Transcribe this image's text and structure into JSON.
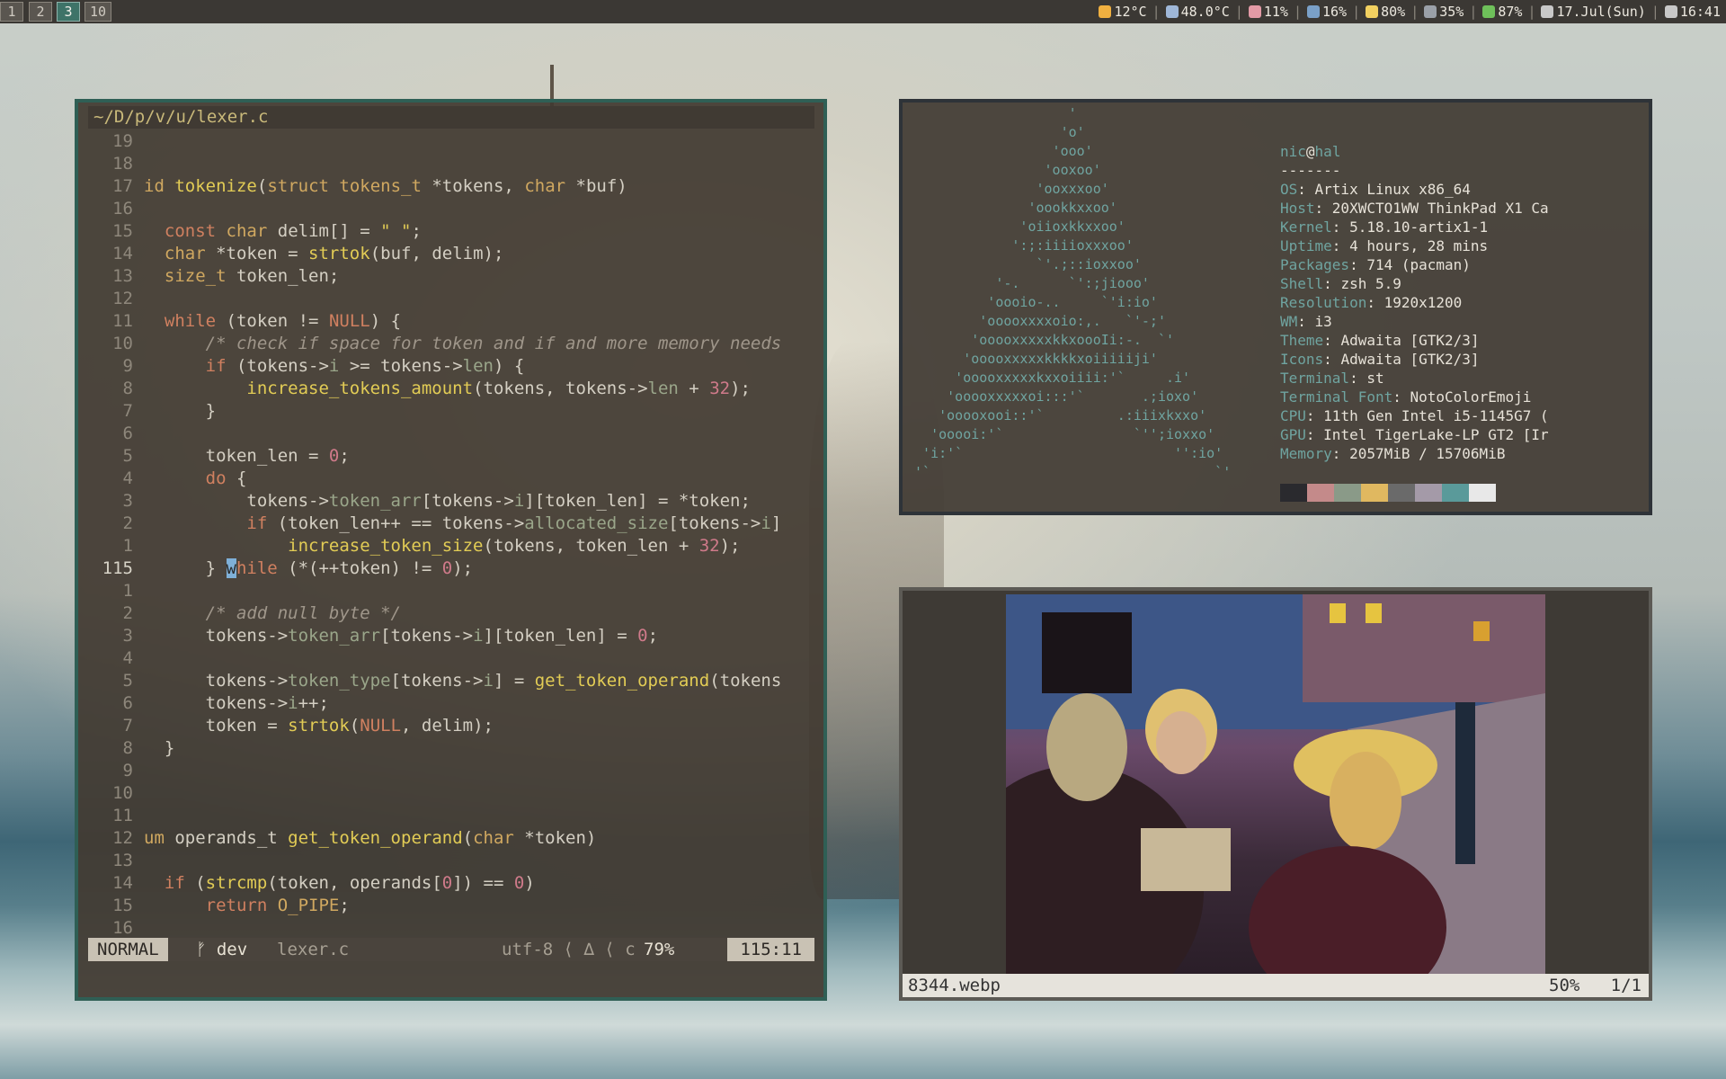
{
  "workspaces": [
    "1",
    "2",
    "3",
    "10"
  ],
  "active_workspace": "3",
  "status": [
    {
      "icon": "sun-icon",
      "text": "12°C",
      "color": "#f0b040"
    },
    {
      "icon": "laptop-icon",
      "text": "48.0°C",
      "color": "#9fb7d8"
    },
    {
      "icon": "brain-icon",
      "text": "11%",
      "color": "#e39aa6"
    },
    {
      "icon": "floppy-icon",
      "text": "16%",
      "color": "#7aa0c8"
    },
    {
      "icon": "bulb-icon",
      "text": "80%",
      "color": "#f2d060"
    },
    {
      "icon": "speaker-icon",
      "text": "35%",
      "color": "#9aa0a8"
    },
    {
      "icon": "battery-icon",
      "text": "87%",
      "color": "#6ec05a"
    },
    {
      "icon": "calendar-icon",
      "text": "17.Jul(Sun)",
      "color": "#c8c8c8"
    },
    {
      "icon": "clock-icon",
      "text": "16:41",
      "color": "#c8c8c8"
    }
  ],
  "vim": {
    "title": "~/D/p/v/u/lexer.c",
    "mode": "NORMAL",
    "branch": "ᚠ dev",
    "file": "lexer.c",
    "encoding": "utf-8 ⟨ ∆ ⟨ c",
    "percent": "79%",
    "position": "115:11"
  },
  "neofetch": {
    "ascii": "                    '\n                   'o'\n                  'ooo'\n                 'ooxoo'\n                'ooxxxoo'\n               'oookkxxoo'\n              'oiioxkkxxoo'\n             ':;:iiiioxxxoo'\n                `'.;::ioxxoo'\n           '-.      `':;jiooo'\n          'oooio-..     `'i:io'\n         'ooooxxxxoio:,.   `'-;'\n        'ooooxxxxxkkxoooIi:-.  `'\n       'ooooxxxxxkkkkxoiiiiiji'\n      'ooooxxxxxkxxoiiii:'`     .i'\n     'ooooxxxxxoi:::'`       .;ioxo'\n    'ooooxooi::'`         .:iiixkxxo'\n   'ooooi:'`                `'';ioxxo'\n  'i:'`                          '':io'\n '`                                   `'",
    "user": "nic",
    "host": "hal",
    "dashes": "-------",
    "fields": [
      {
        "k": "OS",
        "v": "Artix Linux x86_64"
      },
      {
        "k": "Host",
        "v": "20XWCTO1WW ThinkPad X1 Ca"
      },
      {
        "k": "Kernel",
        "v": "5.18.10-artix1-1"
      },
      {
        "k": "Uptime",
        "v": "4 hours, 28 mins"
      },
      {
        "k": "Packages",
        "v": "714 (pacman)"
      },
      {
        "k": "Shell",
        "v": "zsh 5.9"
      },
      {
        "k": "Resolution",
        "v": "1920x1200"
      },
      {
        "k": "WM",
        "v": "i3"
      },
      {
        "k": "Theme",
        "v": "Adwaita [GTK2/3]"
      },
      {
        "k": "Icons",
        "v": "Adwaita [GTK2/3]"
      },
      {
        "k": "Terminal",
        "v": "st"
      },
      {
        "k": "Terminal Font",
        "v": "NotoColorEmoji"
      },
      {
        "k": "CPU",
        "v": "11th Gen Intel i5-1145G7 ("
      },
      {
        "k": "GPU",
        "v": "Intel TigerLake-LP GT2 [Ir"
      },
      {
        "k": "Memory",
        "v": "2057MiB / 15706MiB"
      }
    ],
    "palette": [
      "#2a2a2e",
      "#c48a8a",
      "#8a9a88",
      "#e0b860",
      "#6a6a6a",
      "#a49aa8",
      "#5a9a9a",
      "#e8e8e8"
    ]
  },
  "viewer": {
    "filename": "8344.webp",
    "zoom": "50%",
    "index": "1/1"
  }
}
